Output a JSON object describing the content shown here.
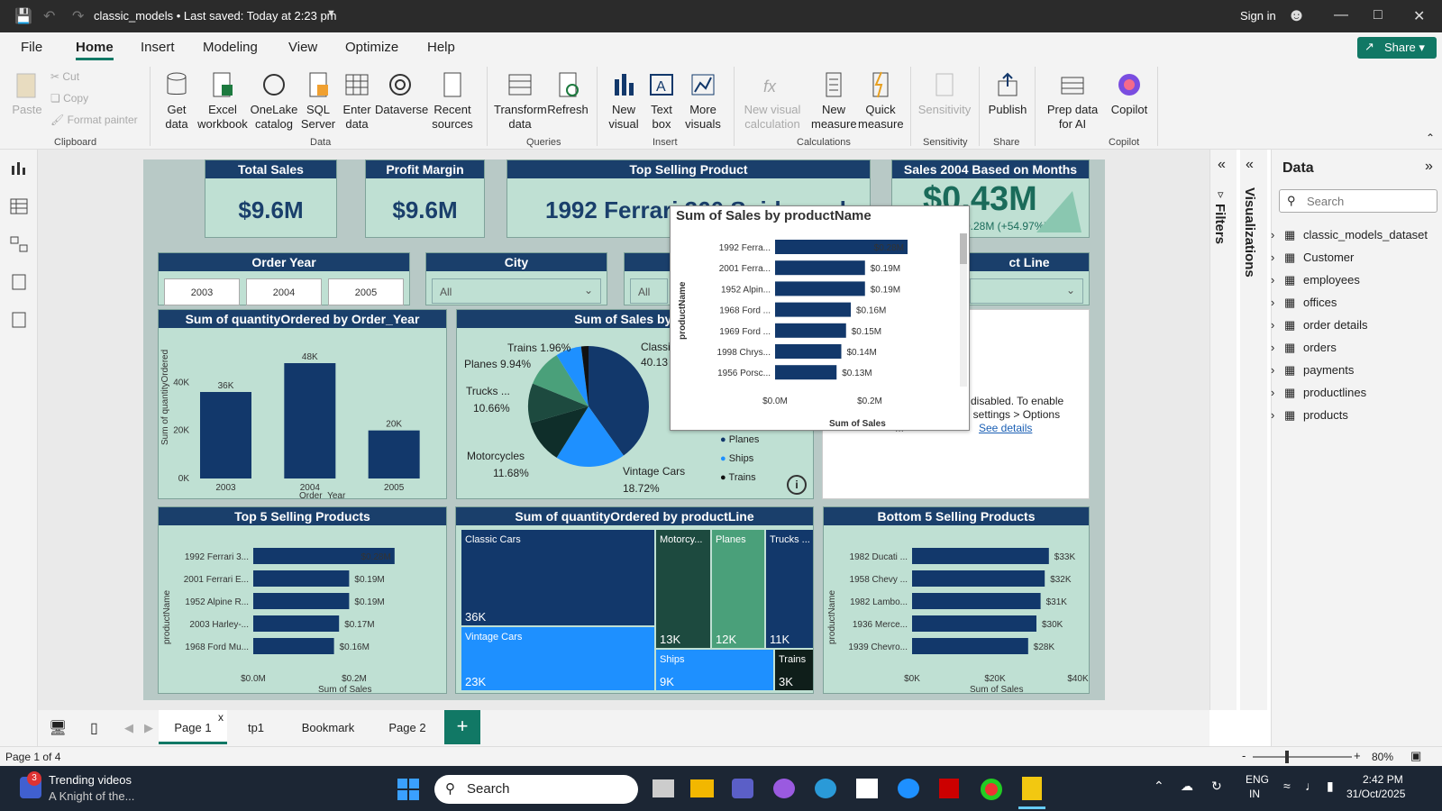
{
  "window": {
    "title": "classic_models • Last saved: Today at 2:23 pm",
    "sign_in": "Sign in"
  },
  "menu": {
    "items": [
      "File",
      "Home",
      "Insert",
      "Modeling",
      "View",
      "Optimize",
      "Help"
    ],
    "active": "Home",
    "share": "Share"
  },
  "ribbon": {
    "clipboard": {
      "paste": "Paste",
      "cut": "Cut",
      "copy": "Copy",
      "format_painter": "Format painter",
      "group": "Clipboard"
    },
    "data": {
      "get_data": "Get data",
      "excel": "Excel workbook",
      "onelake": "OneLake catalog",
      "sql": "SQL Server",
      "enter": "Enter data",
      "dataverse": "Dataverse",
      "recent": "Recent sources",
      "group": "Data"
    },
    "queries": {
      "transform": "Transform data",
      "refresh": "Refresh",
      "group": "Queries"
    },
    "insert": {
      "new_visual": "New visual",
      "text_box": "Text box",
      "more_visuals": "More visuals",
      "group": "Insert"
    },
    "calculations": {
      "new_visual_calc": "New visual calculation",
      "new_measure": "New measure",
      "quick_measure": "Quick measure",
      "group": "Calculations"
    },
    "sensitivity": {
      "label": "Sensitivity",
      "group": "Sensitivity"
    },
    "share": {
      "publish": "Publish",
      "group": "Share"
    },
    "copilot": {
      "prep": "Prep data for AI",
      "copilot": "Copilot",
      "group": "Copilot"
    }
  },
  "report": {
    "total_sales": {
      "title": "Total Sales",
      "value": "$9.6M"
    },
    "profit_margin": {
      "title": "Profit Margin",
      "value": "$9.6M"
    },
    "top_product": {
      "title": "Top Selling Product",
      "value": "1992 Ferrari 360 Spider red"
    },
    "sales_2004": {
      "title": "Sales 2004 Based on Months",
      "value": "$0.43M",
      "sub": "0.28M (+54.97%)"
    },
    "order_year": {
      "title": "Order Year",
      "years": [
        "2003",
        "2004",
        "2005"
      ]
    },
    "city": {
      "title": "City",
      "value": "All"
    },
    "country": {
      "value": "All"
    },
    "product_line": {
      "title": "ct Line"
    },
    "qty_by_year": {
      "title": "Sum of quantityOrdered by Order_Year",
      "ylabel": "Sum of quantityOrdered",
      "xlabel": "Order_Year"
    },
    "pie": {
      "title": "Sum of Sales by pro",
      "labels": [
        "Trains 1.96%",
        "Planes 9.94%",
        "Trucks ...",
        "10.66%",
        "Motorcycles",
        "11.68%",
        "Vintage Cars",
        "18.72%",
        "Classi",
        "40.13"
      ],
      "legend": [
        "Planes",
        "Ships",
        "Trains"
      ]
    },
    "notice": {
      "line1": "re disabled. To enable",
      "line2": "nd settings > Options",
      "line3": "...",
      "link": "See details"
    },
    "top5": {
      "title": "Top 5 Selling Products",
      "ylabel": "productName",
      "xlabel": "Sum of Sales"
    },
    "treemap": {
      "title": "Sum of quantityOrdered by productLine",
      "cells": [
        {
          "name": "Classic Cars",
          "value": "36K"
        },
        {
          "name": "Vintage Cars",
          "value": "23K"
        },
        {
          "name": "Motorcy...",
          "value": "13K"
        },
        {
          "name": "Planes",
          "value": "12K"
        },
        {
          "name": "Trucks ...",
          "value": "11K"
        },
        {
          "name": "Ships",
          "value": "9K"
        },
        {
          "name": "Trains",
          "value": "3K"
        }
      ]
    },
    "bottom5": {
      "title": "Bottom 5 Selling Products",
      "ylabel": "productName",
      "xlabel": "Sum of Sales"
    },
    "tooltip": {
      "title": "Sum of Sales by productName",
      "ylabel": "productName",
      "xlabel": "Sum of Sales"
    }
  },
  "chart_data": [
    {
      "type": "bar",
      "title": "Sum of quantityOrdered by Order_Year",
      "categories": [
        "2003",
        "2004",
        "2005"
      ],
      "values": [
        36000,
        48000,
        20000
      ],
      "data_labels": [
        "36K",
        "48K",
        "20K"
      ],
      "yticks": [
        "0K",
        "20K",
        "40K"
      ],
      "ylim": [
        0,
        48000
      ],
      "xlabel": "Order_Year",
      "ylabel": "Sum of quantityOrdered"
    },
    {
      "type": "pie",
      "title": "Sum of Sales by pro",
      "categories": [
        "Classic Cars",
        "Vintage Cars",
        "Motorcycles",
        "Trucks",
        "Planes",
        "Ships",
        "Trains"
      ],
      "values": [
        40.13,
        18.72,
        11.68,
        10.66,
        9.94,
        6.91,
        1.96
      ]
    },
    {
      "type": "bar",
      "title": "Top 5 Selling Products",
      "categories": [
        "1992 Ferrari 3...",
        "2001 Ferrari E...",
        "1952 Alpine R...",
        "2003 Harley-...",
        "1968 Ford Mu..."
      ],
      "values": [
        0.28,
        0.19,
        0.19,
        0.17,
        0.16
      ],
      "data_labels": [
        "$0.28M",
        "$0.19M",
        "$0.19M",
        "$0.17M",
        "$0.16M"
      ],
      "xticks": [
        "$0.0M",
        "$0.2M"
      ],
      "xlim": [
        0,
        0.3
      ],
      "xlabel": "Sum of Sales",
      "ylabel": "productName"
    },
    {
      "type": "bar",
      "title": "Bottom 5 Selling Products",
      "categories": [
        "1982 Ducati ...",
        "1958 Chevy ...",
        "1982 Lambo...",
        "1936 Merce...",
        "1939 Chevro..."
      ],
      "values": [
        33,
        32,
        31,
        30,
        28
      ],
      "data_labels": [
        "$33K",
        "$32K",
        "$31K",
        "$30K",
        "$28K"
      ],
      "xticks": [
        "$0K",
        "$20K",
        "$40K"
      ],
      "xlim": [
        0,
        40
      ],
      "xlabel": "Sum of Sales",
      "ylabel": "productName"
    },
    {
      "type": "bar",
      "title": "Sum of Sales by productName",
      "categories": [
        "1992 Ferra...",
        "2001 Ferra...",
        "1952 Alpin...",
        "1968 Ford ...",
        "1969 Ford ...",
        "1998 Chrys...",
        "1956 Porsc..."
      ],
      "values": [
        0.28,
        0.19,
        0.19,
        0.16,
        0.15,
        0.14,
        0.13
      ],
      "data_labels": [
        "$0.28M",
        "$0.19M",
        "$0.19M",
        "$0.16M",
        "$0.15M",
        "$0.14M",
        "$0.13M"
      ],
      "xticks": [
        "$0.0M",
        "$0.2M"
      ],
      "xlim": [
        0,
        0.28
      ],
      "xlabel": "Sum of Sales",
      "ylabel": "productName"
    }
  ],
  "panes": {
    "filters": "Filters",
    "visualizations": "Visualizations",
    "data_title": "Data",
    "search_placeholder": "Search",
    "tables": [
      "classic_models_dataset",
      "Customer",
      "employees",
      "offices",
      "order details",
      "orders",
      "payments",
      "productlines",
      "products"
    ]
  },
  "tabs": {
    "pages": [
      "Page 1",
      "tp1",
      "Bookmark",
      "Page 2"
    ],
    "active": "Page 1",
    "add": "+"
  },
  "status": {
    "page": "Page 1 of 4",
    "zoom": "80%"
  },
  "taskbar": {
    "news_title": "Trending videos",
    "news_sub": "A Knight of the...",
    "badge": "3",
    "search": "Search",
    "lang1": "ENG",
    "lang2": "IN",
    "time": "2:42 PM",
    "date": "31/Oct/2025"
  }
}
